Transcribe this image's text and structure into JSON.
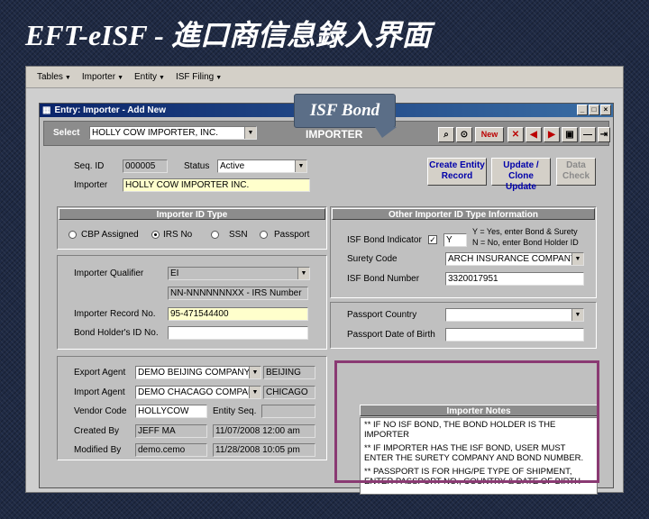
{
  "slide_title": "EFT-eISF  - 進口商信息錄入界面",
  "menu": [
    {
      "label": "Tables"
    },
    {
      "label": "Importer"
    },
    {
      "label": "Entity"
    },
    {
      "label": "ISF Filing"
    }
  ],
  "form_window": {
    "title": "Entry: Importer - Add New",
    "controls": [
      "_",
      "□",
      "×"
    ]
  },
  "header": {
    "select_label": "Select",
    "select_value": "HOLLY COW IMPORTER, INC.",
    "heading": "IMPORTER",
    "new_label": "New"
  },
  "top_fields": {
    "seq_id_label": "Seq. ID",
    "seq_id_value": "000005",
    "status_label": "Status",
    "status_value": "Active",
    "importer_label": "Importer",
    "importer_value": "HOLLY COW IMPORTER INC."
  },
  "callout": "ISF Bond",
  "action_buttons": {
    "create_entity": "Create Entity Record",
    "update_clone": "Update / Clone Update",
    "data_check": "Data Check"
  },
  "importer_id_type": {
    "heading": "Importer ID Type",
    "options": [
      "CBP Assigned",
      "IRS No",
      "SSN",
      "Passport"
    ],
    "selected": "IRS No",
    "qualifier_label": "Importer Qualifier",
    "qualifier_value": "EI",
    "format_hint": "NN-NNNNNNNXX - IRS Number",
    "record_no_label": "Importer Record No.",
    "record_no_value": "95-471544400",
    "bond_holder_label": "Bond Holder's ID No.",
    "bond_holder_value": ""
  },
  "other_id_type": {
    "heading": "Other Importer ID Type Information",
    "bond_indicator_label": "ISF Bond Indicator",
    "bond_indicator_checked": true,
    "bond_indicator_value": "Y",
    "bond_hint_1": "Y = Yes, enter Bond & Surety",
    "bond_hint_2": "N = No, enter Bond Holder ID",
    "surety_label": "Surety Code",
    "surety_value": "ARCH INSURANCE COMPANY",
    "bond_number_label": "ISF Bond Number",
    "bond_number_value": "3320017951",
    "passport_country_label": "Passport Country",
    "passport_country_value": "",
    "passport_dob_label": "Passport Date of Birth",
    "passport_dob_value": ""
  },
  "agents": {
    "export_agent_label": "Export Agent",
    "export_agent_value": "DEMO BEIJING COMPANY",
    "export_agent_city": "BEIJING",
    "import_agent_label": "Import Agent",
    "import_agent_value": "DEMO CHACAGO COMPANY",
    "import_agent_city": "CHICAGO",
    "vendor_code_label": "Vendor Code",
    "vendor_code_value": "HOLLYCOW",
    "entity_seq_label": "Entity Seq.",
    "entity_seq_value": "",
    "created_by_label": "Created By",
    "created_by_value": "JEFF MA",
    "created_time": "11/07/2008 12:00 am",
    "modified_by_label": "Modified By",
    "modified_by_value": "demo.cemo",
    "modified_time": "11/28/2008 10:05 pm"
  },
  "notes": {
    "heading": "Importer Notes",
    "lines": [
      "** IF NO ISF BOND, THE BOND HOLDER IS THE IMPORTER",
      "** IF IMPORTER HAS THE ISF BOND, USER MUST ENTER THE SURETY COMPANY AND BOND NUMBER.",
      "** PASSPORT IS FOR HHG/PE TYPE OF SHIPMENT, ENTER PASSPORT NO., COUNTRY & DATE OF BIRTH"
    ]
  },
  "colors": {
    "title_bar": "#0a246a",
    "section_head": "#8c8c8c",
    "highlight": "#8a3a73",
    "callout": "#5b6e87"
  }
}
